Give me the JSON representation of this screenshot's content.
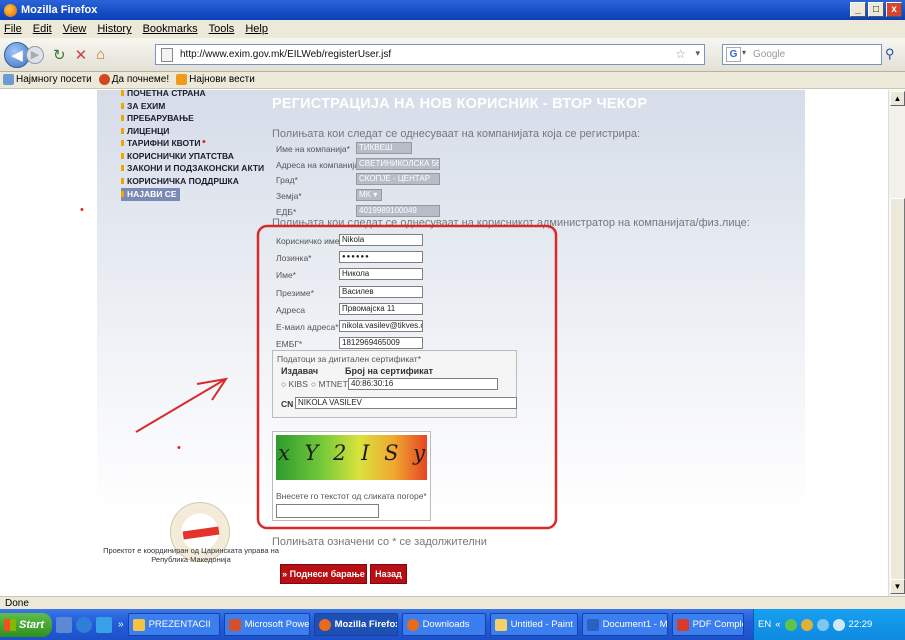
{
  "window": {
    "title": "Mozilla Firefox",
    "buttons": [
      "_",
      "□",
      "x"
    ]
  },
  "menu": [
    "File",
    "Edit",
    "View",
    "History",
    "Bookmarks",
    "Tools",
    "Help"
  ],
  "nav": {
    "url": "http://www.exim.gov.mk/EILWeb/registerUser.jsf",
    "search_placeholder": "Google"
  },
  "bookmarks": [
    "Најмногу посети",
    "Да почнеме!",
    "Најнови вести"
  ],
  "sidebar": {
    "items": [
      "ПОЧЕТНА СТРАНА",
      "ЗА ЕХИМ",
      "ПРЕБАРУВАЊЕ",
      "ЛИЦЕНЦИ",
      "ТАРИФНИ КВОТИ",
      "КОРИСНИЧКИ УПАТСТВА",
      "ЗАКОНИ И ПОДЗАКОНСКИ АКТИ",
      "КОРИСНИЧКА ПОДДРШКА",
      "НАЈАВИ СЕ"
    ]
  },
  "page": {
    "title": "РЕГИСТРАЦИЈА НА НОВ КОРИСНИК - ВТОР ЧЕКОР",
    "company_intro": "Полињата кои следат се однесуваат на компанијата која се регистрира:",
    "company_fields": [
      {
        "label": "Име на компанија*",
        "value": "ТИКВЕШ"
      },
      {
        "label": "Адреса на компанија*",
        "value": "СВЕТИНИКОЛСКА 56"
      },
      {
        "label": "Град*",
        "value": "СКОПЈЕ - ЦЕНТАР"
      },
      {
        "label": "Земја*",
        "value": "MK"
      },
      {
        "label": "ЕДБ*",
        "value": "4019989100049"
      }
    ],
    "admin_intro": "Полињата кои следат се однесуваат на корисникот администратор на компанијата/физ.лице:",
    "user_fields": [
      {
        "label": "Корисничко име*",
        "value": "Nikola"
      },
      {
        "label": "Лозинка*",
        "value": "●●●●●●"
      },
      {
        "label": "Име*",
        "value": "Никола"
      },
      {
        "label": "Презиме*",
        "value": "Василев"
      },
      {
        "label": "Адреса",
        "value": "Првомајска 11"
      },
      {
        "label": "Е-маил адреса*",
        "value": "nikola.vasilev@tikves.co"
      },
      {
        "label": "ЕМБГ*",
        "value": "1812969465009"
      }
    ],
    "cert": {
      "title": "Податоци за дигитален сертификат*",
      "issuer_label": "Издавач",
      "number_label": "Број на сертификат",
      "option1": "KIBS",
      "option2": "MTNET",
      "number_value": "40:86:30:16",
      "cn_label": "CN",
      "cn_value": "NIKOLA VASILEV"
    },
    "captcha": {
      "image_text": "x Y 2 I S y 2",
      "prompt": "Внесете го текстот од сликата погоре*",
      "value": ""
    },
    "required_note": "Полињата означени со * се задолжителни",
    "submit_label": "» Поднеси барање",
    "back_label": "Назад",
    "footer_text": "Проектот е координиран од Царинската управа на Република Македонија"
  },
  "status": "Done",
  "taskbar": {
    "start": "Start",
    "tasks": [
      "PREZENTACII",
      "Microsoft PowerP...",
      "Mozilla Firefox",
      "Downloads",
      "Untitled - Paint",
      "Document1 - Micr...",
      "PDF Complete"
    ],
    "lang": "EN",
    "clock": "22:29"
  },
  "colors": {
    "titlebar": "#0a3fb8",
    "accent_red": "#b80f14",
    "annotation_red": "#d92a2a",
    "page_bg": "#d6dde9"
  }
}
